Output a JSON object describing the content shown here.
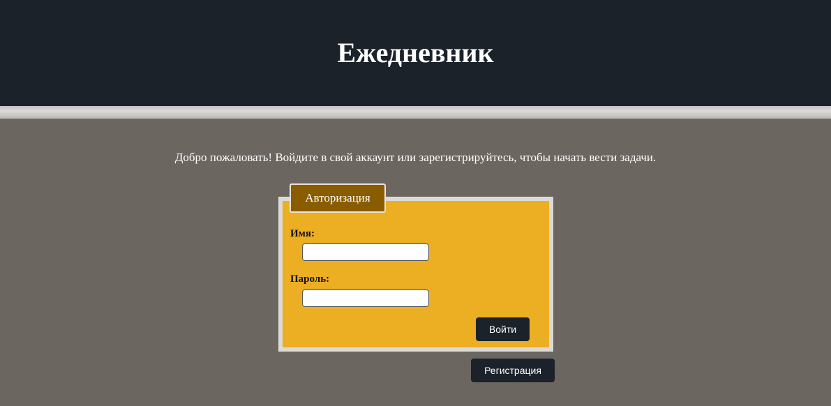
{
  "header": {
    "title": "Ежедневник"
  },
  "main": {
    "welcome_text": "Добро пожаловать! Войдите в свой аккаунт или зарегистрируйтесь, чтобы начать вести задачи."
  },
  "login_form": {
    "legend": "Авторизация",
    "name_label": "Имя:",
    "name_value": "",
    "password_label": "Пароль:",
    "password_value": "",
    "submit_label": "Войти"
  },
  "register_button_label": "Регистрация",
  "colors": {
    "header_bg": "#1c222a",
    "page_bg": "#6b6660",
    "form_bg": "#ecae22",
    "legend_bg": "#8a5c00",
    "button_bg": "#1c222a"
  }
}
